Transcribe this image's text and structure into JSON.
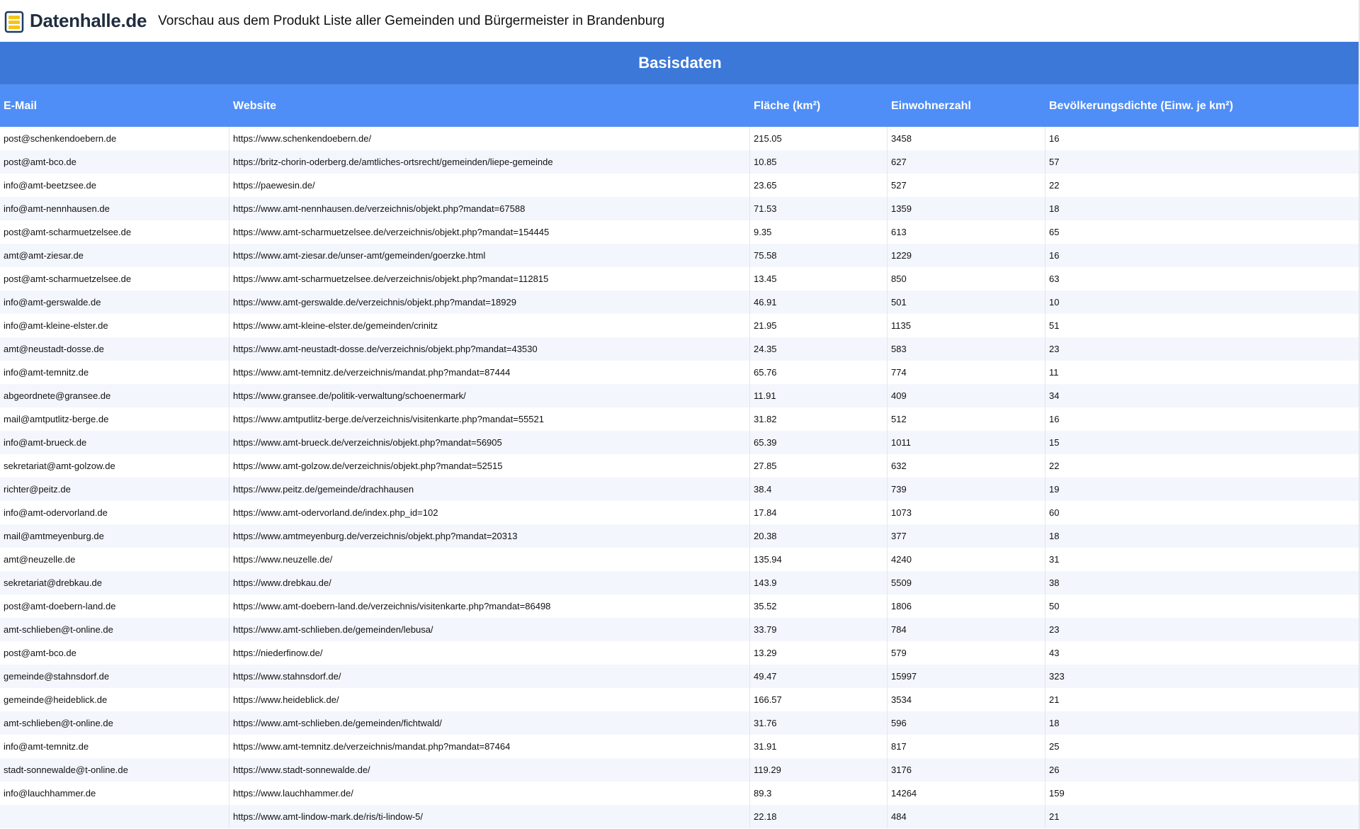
{
  "brand": {
    "name": "Datenhalle.de",
    "logo_icon": "database-stack-icon",
    "colors": {
      "logo_blue": "#1f3b5c",
      "logo_yellow": "#f5c518"
    }
  },
  "page": {
    "title": "Vorschau aus dem Produkt Liste aller Gemeinden und Bürgermeister in Brandenburg"
  },
  "table": {
    "group_title": "Basisdaten",
    "columns": [
      "E-Mail",
      "Website",
      "Fläche (km²)",
      "Einwohnerzahl",
      "Bevölkerungsdichte (Einw. je km²)"
    ],
    "rows": [
      [
        "post@schenkendoebern.de",
        "https://www.schenkendoebern.de/",
        "215.05",
        "3458",
        "16"
      ],
      [
        "post@amt-bco.de",
        "https://britz-chorin-oderberg.de/amtliches-ortsrecht/gemeinden/liepe-gemeinde",
        "10.85",
        "627",
        "57"
      ],
      [
        "info@amt-beetzsee.de",
        "https://paewesin.de/",
        "23.65",
        "527",
        "22"
      ],
      [
        "info@amt-nennhausen.de",
        "https://www.amt-nennhausen.de/verzeichnis/objekt.php?mandat=67588",
        "71.53",
        "1359",
        "18"
      ],
      [
        "post@amt-scharmuetzelsee.de",
        "https://www.amt-scharmuetzelsee.de/verzeichnis/objekt.php?mandat=154445",
        "9.35",
        "613",
        "65"
      ],
      [
        "amt@amt-ziesar.de",
        "https://www.amt-ziesar.de/unser-amt/gemeinden/goerzke.html",
        "75.58",
        "1229",
        "16"
      ],
      [
        "post@amt-scharmuetzelsee.de",
        "https://www.amt-scharmuetzelsee.de/verzeichnis/objekt.php?mandat=112815",
        "13.45",
        "850",
        "63"
      ],
      [
        "info@amt-gerswalde.de",
        "https://www.amt-gerswalde.de/verzeichnis/objekt.php?mandat=18929",
        "46.91",
        "501",
        "10"
      ],
      [
        "info@amt-kleine-elster.de",
        "https://www.amt-kleine-elster.de/gemeinden/crinitz",
        "21.95",
        "1135",
        "51"
      ],
      [
        "amt@neustadt-dosse.de",
        "https://www.amt-neustadt-dosse.de/verzeichnis/objekt.php?mandat=43530",
        "24.35",
        "583",
        "23"
      ],
      [
        "info@amt-temnitz.de",
        "https://www.amt-temnitz.de/verzeichnis/mandat.php?mandat=87444",
        "65.76",
        "774",
        "11"
      ],
      [
        "abgeordnete@gransee.de",
        "https://www.gransee.de/politik-verwaltung/schoenermark/",
        "11.91",
        "409",
        "34"
      ],
      [
        "mail@amtputlitz-berge.de",
        "https://www.amtputlitz-berge.de/verzeichnis/visitenkarte.php?mandat=55521",
        "31.82",
        "512",
        "16"
      ],
      [
        "info@amt-brueck.de",
        "https://www.amt-brueck.de/verzeichnis/objekt.php?mandat=56905",
        "65.39",
        "1011",
        "15"
      ],
      [
        "sekretariat@amt-golzow.de",
        "https://www.amt-golzow.de/verzeichnis/objekt.php?mandat=52515",
        "27.85",
        "632",
        "22"
      ],
      [
        "richter@peitz.de",
        "https://www.peitz.de/gemeinde/drachhausen",
        "38.4",
        "739",
        "19"
      ],
      [
        "info@amt-odervorland.de",
        "https://www.amt-odervorland.de/index.php_id=102",
        "17.84",
        "1073",
        "60"
      ],
      [
        "mail@amtmeyenburg.de",
        "https://www.amtmeyenburg.de/verzeichnis/objekt.php?mandat=20313",
        "20.38",
        "377",
        "18"
      ],
      [
        "amt@neuzelle.de",
        "https://www.neuzelle.de/",
        "135.94",
        "4240",
        "31"
      ],
      [
        "sekretariat@drebkau.de",
        "https://www.drebkau.de/",
        "143.9",
        "5509",
        "38"
      ],
      [
        "post@amt-doebern-land.de",
        "https://www.amt-doebern-land.de/verzeichnis/visitenkarte.php?mandat=86498",
        "35.52",
        "1806",
        "50"
      ],
      [
        "amt-schlieben@t-online.de",
        "https://www.amt-schlieben.de/gemeinden/lebusa/",
        "33.79",
        "784",
        "23"
      ],
      [
        "post@amt-bco.de",
        "https://niederfinow.de/",
        "13.29",
        "579",
        "43"
      ],
      [
        "gemeinde@stahnsdorf.de",
        "https://www.stahnsdorf.de/",
        "49.47",
        "15997",
        "323"
      ],
      [
        "gemeinde@heideblick.de",
        "https://www.heideblick.de/",
        "166.57",
        "3534",
        "21"
      ],
      [
        "amt-schlieben@t-online.de",
        "https://www.amt-schlieben.de/gemeinden/fichtwald/",
        "31.76",
        "596",
        "18"
      ],
      [
        "info@amt-temnitz.de",
        "https://www.amt-temnitz.de/verzeichnis/mandat.php?mandat=87464",
        "31.91",
        "817",
        "25"
      ],
      [
        "stadt-sonnewalde@t-online.de",
        "https://www.stadt-sonnewalde.de/",
        "119.29",
        "3176",
        "26"
      ],
      [
        "info@lauchhammer.de",
        "https://www.lauchhammer.de/",
        "89.3",
        "14264",
        "159"
      ],
      [
        "",
        "https://www.amt-lindow-mark.de/ris/ti-lindow-5/",
        "22.18",
        "484",
        "21"
      ]
    ]
  }
}
